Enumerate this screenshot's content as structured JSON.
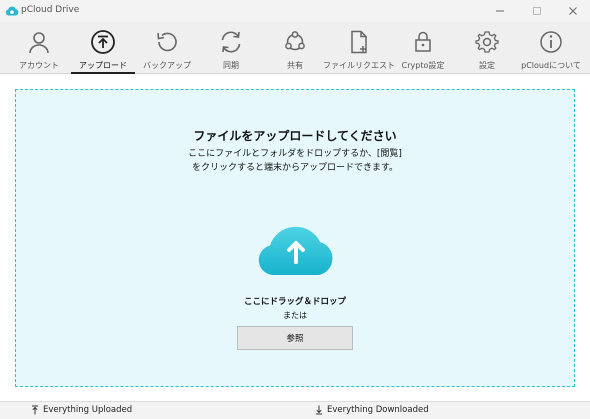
{
  "window": {
    "title": "pCloud Drive"
  },
  "toolbar": {
    "items": [
      {
        "label": "アカウント",
        "icon": "account-icon"
      },
      {
        "label": "アップロード",
        "icon": "upload-icon",
        "active": true
      },
      {
        "label": "バックアップ",
        "icon": "backup-icon"
      },
      {
        "label": "同期",
        "icon": "sync-icon"
      },
      {
        "label": "共有",
        "icon": "share-icon"
      },
      {
        "label": "ファイルリクエスト",
        "icon": "file-request-icon"
      },
      {
        "label": "Crypto設定",
        "icon": "lock-icon"
      },
      {
        "label": "設定",
        "icon": "gear-icon"
      },
      {
        "label": "pCloudについて",
        "icon": "info-icon"
      }
    ]
  },
  "upload": {
    "title": "ファイルをアップロードしてください",
    "desc_line1": "ここにファイルとフォルダをドロップするか、[閲覧]",
    "desc_line2": "をクリックすると端末からアップロードできます。",
    "drop_here": "ここにドラッグ＆ドロップ",
    "or": "または",
    "browse": "参照"
  },
  "status": {
    "uploaded": "Everything Uploaded",
    "downloaded": "Everything Downloaded"
  },
  "colors": {
    "accent": "#2fbfd3",
    "dropzone_bg": "#e6f8fb"
  }
}
